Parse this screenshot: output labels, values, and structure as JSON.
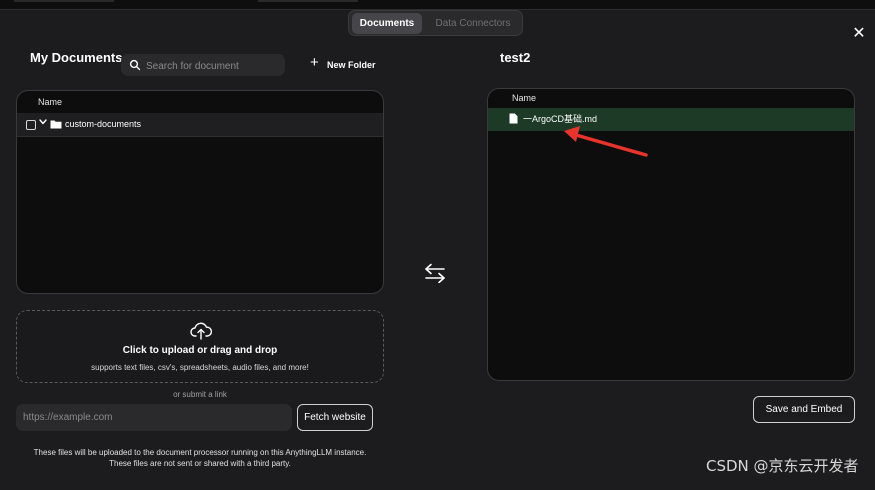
{
  "tabs": [
    {
      "label": "Documents",
      "active": true
    },
    {
      "label": "Data Connectors",
      "active": false
    }
  ],
  "left": {
    "title": "My Documents",
    "search_placeholder": "Search for document",
    "new_folder_label": "New Folder",
    "table_header": "Name",
    "folders": [
      {
        "name": "custom-documents"
      }
    ]
  },
  "upload": {
    "main_text": "Click to upload or drag and drop",
    "sub_text": "supports text files, csv's, spreadsheets, audio files, and more!",
    "or_link_text": "or submit a link",
    "url_placeholder": "https://example.com",
    "fetch_label": "Fetch website",
    "notice_line1": "These files will be uploaded to the document processor running on this AnythingLLM instance.",
    "notice_line2": "These files are not sent or shared with a third party."
  },
  "right": {
    "title": "test2",
    "table_header": "Name",
    "files": [
      {
        "name": "一ArgoCD基础.md"
      }
    ],
    "save_label": "Save and Embed"
  },
  "watermark": "CSDN @京东云开发者",
  "colors": {
    "modal_bg": "#1c1c1e",
    "panel_bg": "#0d0d0d",
    "selected_file_bg": "#1c3a25",
    "annotation_arrow": "#e8342a"
  },
  "icons": [
    "search-icon",
    "plus-icon",
    "close-icon",
    "checkbox-icon",
    "chevron-down-icon",
    "folder-icon",
    "file-icon",
    "upload-cloud-icon",
    "swap-arrows-icon",
    "annotation-arrow"
  ]
}
